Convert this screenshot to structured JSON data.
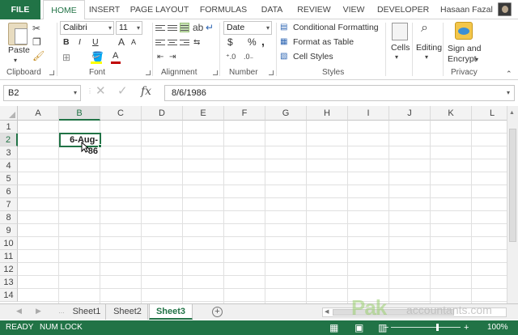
{
  "tabs": [
    "FILE",
    "HOME",
    "INSERT",
    "PAGE LAYOUT",
    "FORMULAS",
    "DATA",
    "REVIEW",
    "VIEW",
    "DEVELOPER"
  ],
  "user": {
    "name": "Hasaan Fazal"
  },
  "clipboard": {
    "paste_label": "Paste",
    "group_label": "Clipboard"
  },
  "font": {
    "family": "Calibri",
    "size": "11",
    "bold": "B",
    "italic": "I",
    "underline": "U",
    "grow": "A",
    "shrink": "A",
    "font_color": "A",
    "group_label": "Font"
  },
  "alignment": {
    "group_label": "Alignment"
  },
  "number": {
    "format": "Date",
    "currency": "$",
    "percent": "%",
    "comma": ",",
    "group_label": "Number"
  },
  "styles": {
    "conditional": "Conditional Formatting",
    "format_table": "Format as Table",
    "cell_styles": "Cell Styles",
    "group_label": "Styles"
  },
  "cells": {
    "label": "Cells"
  },
  "editing": {
    "label": "Editing"
  },
  "privacy": {
    "sign_line1": "Sign and",
    "sign_line2": "Encrypt",
    "group_label": "Privacy"
  },
  "formula_bar": {
    "name_box": "B2",
    "fx": "fx",
    "formula": "8/6/1986"
  },
  "grid": {
    "columns": [
      "A",
      "B",
      "C",
      "D",
      "E",
      "F",
      "G",
      "H",
      "I",
      "J",
      "K",
      "L"
    ],
    "rows": [
      "1",
      "2",
      "3",
      "4",
      "5",
      "6",
      "7",
      "8",
      "9",
      "10",
      "11",
      "12",
      "13",
      "14"
    ],
    "active_column": "B",
    "active_row": "2",
    "b2_value": "6-Aug-86"
  },
  "sheets": [
    "Sheet1",
    "Sheet2",
    "Sheet3"
  ],
  "active_sheet": "Sheet3",
  "status": {
    "ready": "READY",
    "num_lock": "NUM LOCK",
    "zoom": "100%"
  },
  "watermark": {
    "brand": "Pak",
    "site": "accountants.com"
  },
  "colors": {
    "accent": "#217346"
  },
  "icons": [
    "cut-icon",
    "copy-icon",
    "format-painter-icon",
    "fill-color-icon",
    "borders-icon",
    "wrap-text-icon",
    "merge-icon",
    "cells-icon",
    "binoculars-icon",
    "sign-encrypt-icon"
  ]
}
